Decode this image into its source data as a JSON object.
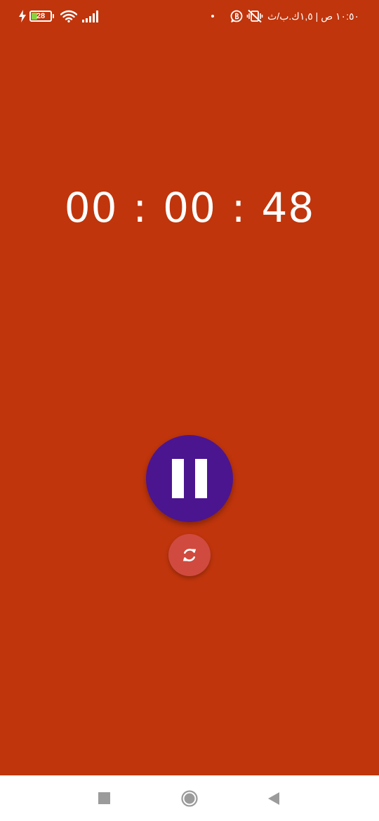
{
  "status_bar": {
    "time": "١٠:٥٠ ص | ١,٥ك.ب/ث",
    "battery_level": "28",
    "battery_fraction": 0.28,
    "icons": {
      "charging": "lightning-icon",
      "battery": "battery-icon",
      "wifi": "wifi-icon",
      "signal": "signal-icon",
      "notification_dot": "dot-icon",
      "whatsapp_business": "whatsapp-business-icon",
      "vibrate_off": "vibrate-off-icon"
    }
  },
  "timer": {
    "hours": "00",
    "minutes": "00",
    "seconds": "48",
    "separator": ":"
  },
  "controls": {
    "pause_icon": "pause-icon",
    "reset_icon": "reset-icon"
  },
  "nav_bar": {
    "recents_icon": "square-icon",
    "home_icon": "circle-icon",
    "back_icon": "triangle-back-icon"
  },
  "colors": {
    "background": "#c0350c",
    "pause_button": "#4b1590",
    "reset_button": "#d04a40",
    "battery_fill": "#8bd13f",
    "nav_bar": "#ffffff",
    "nav_icons": "#9b9b9b"
  }
}
